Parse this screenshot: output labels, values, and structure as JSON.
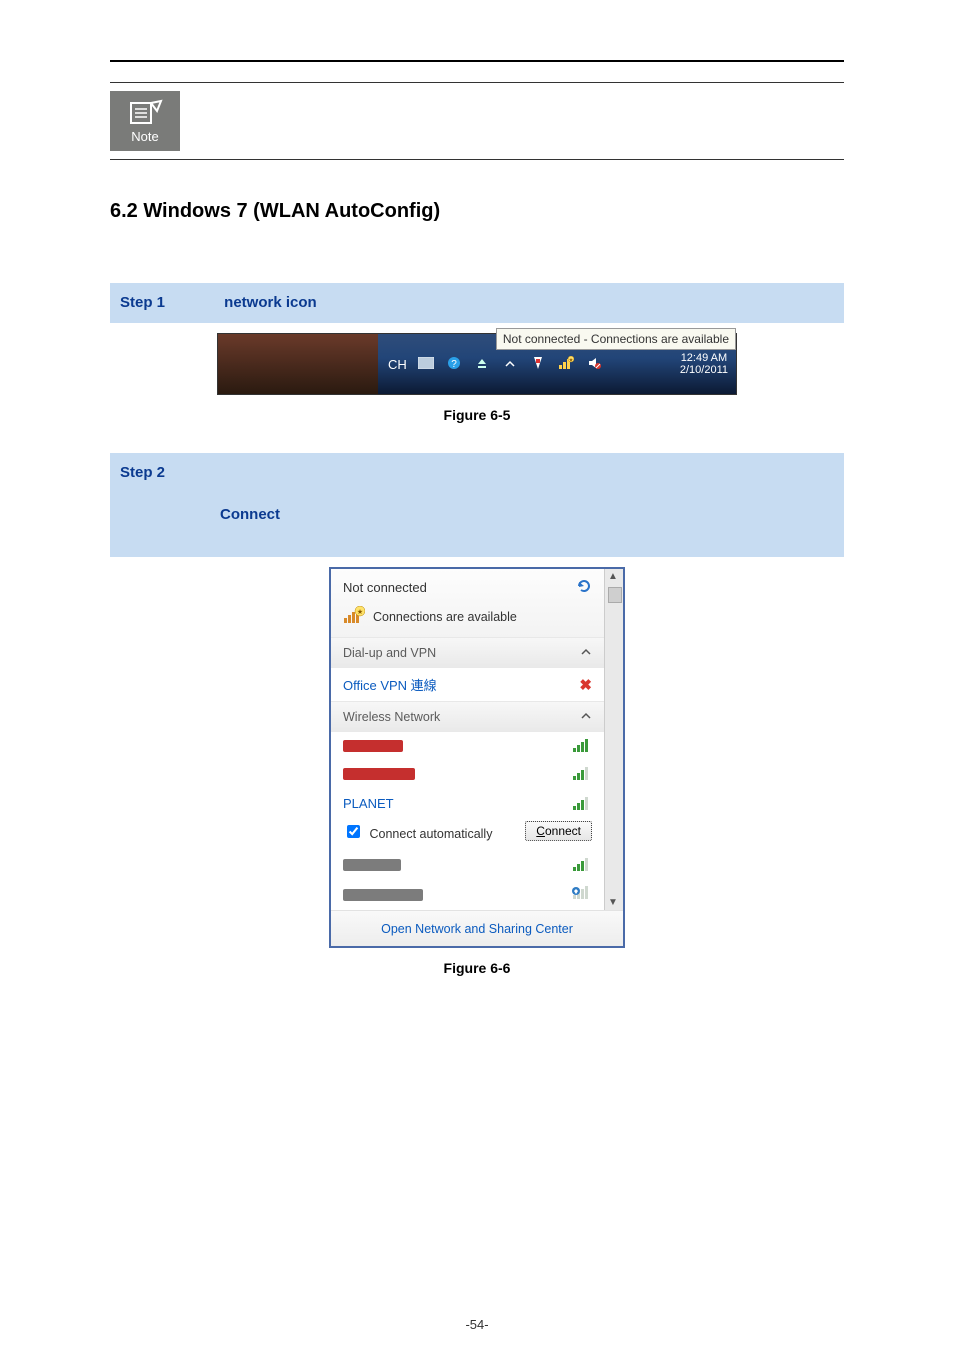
{
  "note_icon_label": "Note",
  "section_heading": "6.2  Windows 7 (WLAN AutoConfig)",
  "step1": {
    "no": "Step 1",
    "bold": "network icon"
  },
  "taskbar": {
    "tooltip": "Not connected - Connections are available",
    "ch": "CH",
    "clock_time": "12:49 AM",
    "clock_date": "2/10/2011"
  },
  "caption1": "Figure 6-5",
  "step2": {
    "no": "Step 2",
    "bold": "Connect"
  },
  "wifi": {
    "not_connected": "Not connected",
    "connections_available": "Connections are available",
    "dialup_header": "Dial-up and VPN",
    "office_vpn": "Office VPN 連線",
    "wireless_header": "Wireless Network",
    "selected_ssid": "PLANET",
    "connect_auto": "Connect automatically",
    "connect_btn": "Connect",
    "footer": "Open Network and Sharing Center"
  },
  "caption2": "Figure 6-6",
  "page_number": "-54-"
}
